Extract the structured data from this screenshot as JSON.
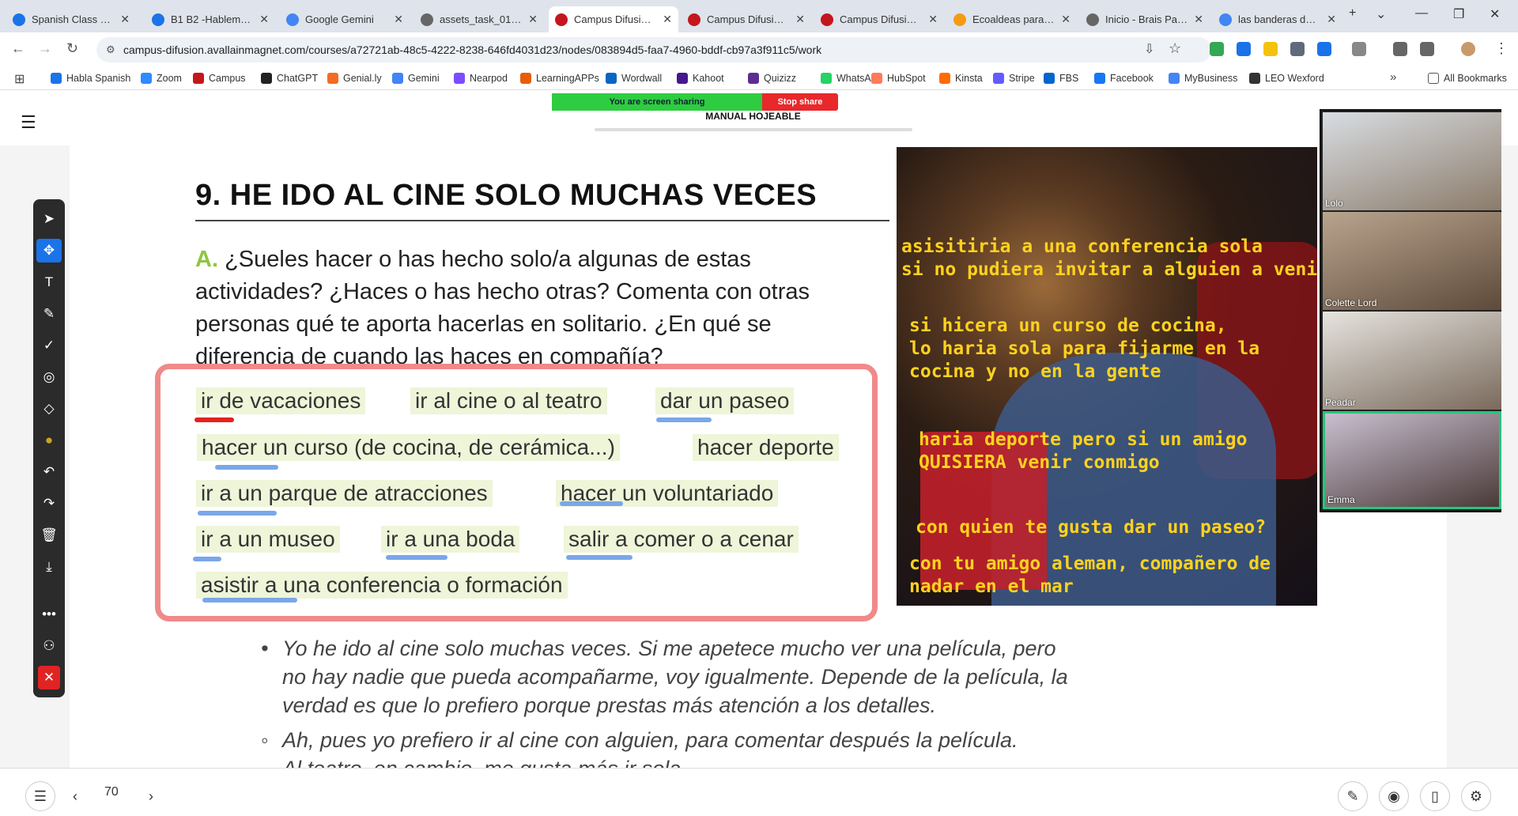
{
  "browser": {
    "tabs": [
      {
        "title": "Spanish Class Notes",
        "color": "#1a73e8"
      },
      {
        "title": "B1 B2 -Hablemos de",
        "color": "#1a73e8"
      },
      {
        "title": "Google Gemini",
        "color": "#4285f4"
      },
      {
        "title": "assets_task_01jz3g",
        "color": "#666666"
      },
      {
        "title": "Campus Difusión | Ba",
        "color": "#c4161c"
      },
      {
        "title": "Campus Difusión | Ba",
        "color": "#c4161c"
      },
      {
        "title": "Campus Difusión | Ba",
        "color": "#c4161c"
      },
      {
        "title": "Ecoaldeas para hacer",
        "color": "#f39c12"
      },
      {
        "title": "Inicio - Brais Palmás",
        "color": "#666666"
      },
      {
        "title": "las banderas de las",
        "color": "#4285f4"
      }
    ],
    "url": "campus-difusion.avallainmagnet.com/courses/a72721ab-48c5-4222-8238-646fd4031d23/nodes/083894d5-faa7-4960-bddf-cb97a3f911c5/work",
    "bookmarks": [
      "Habla Spanish",
      "Zoom",
      "Campus",
      "ChatGPT",
      "Genial.ly",
      "Gemini",
      "Nearpod",
      "LearningAPPs",
      "Wordwall",
      "Kahoot",
      "Quizizz",
      "WhatsApp",
      "HubSpot",
      "Kinsta",
      "Stripe",
      "FBS",
      "Facebook",
      "MyBusiness",
      "LEO Wexford"
    ],
    "all_bookmarks": "All Bookmarks"
  },
  "app": {
    "sharing_text": "You are screen sharing",
    "stop_share": "Stop share",
    "book_title": "MANUAL HOJEABLE"
  },
  "page": {
    "heading": "9.  HE IDO AL CINE SOLO MUCHAS VECES",
    "letter": "A.",
    "question": "¿Sueles hacer o has hecho solo/a algunas de estas actividades? ¿Haces o has hecho otras? Comenta con otras personas qué te aporta hacerlas en solitario. ¿En qué se diferencia de cuando las haces en compañía?",
    "activities": [
      "ir de vacaciones",
      "ir al cine o al teatro",
      "dar un paseo",
      "hacer un curso (de cocina, de cerámica...)",
      "hacer deporte",
      "ir a un parque de atracciones",
      "hacer un voluntariado",
      "ir a un museo",
      "ir a una boda",
      "salir a comer o a cenar",
      "asistir a una conferencia o formación"
    ],
    "bullet1": "Yo he ido al cine solo muchas veces. Si me apetece mucho ver una película, pero\nno hay nadie que pueda acompañarme, voy igualmente. Depende de la película, la\nverdad es que lo prefiero porque prestas más atención a los detalles.",
    "bullet2": "Ah, pues yo prefiero ir al cine con alguien, para comentar después la película.",
    "bullet3": "Al teatro, en cambio, me gusta más ir sola."
  },
  "overlay_notes": [
    "asisitiria a una conferencia sola\nsi no pudiera invitar a alguien a venir",
    "si hicera un curso de cocina,\nlo haria sola para fijarme en la\ncocina y no en la gente",
    "haria deporte pero si un amigo\nQUISIERA venir conmigo",
    "con quien te gusta dar un paseo?",
    "con tu amigo aleman, compañero de\nnadar en el mar"
  ],
  "participants": [
    "Lolo",
    "Colette Lord",
    "Peadar",
    "Emma"
  ],
  "footer": {
    "page_number": "70"
  }
}
